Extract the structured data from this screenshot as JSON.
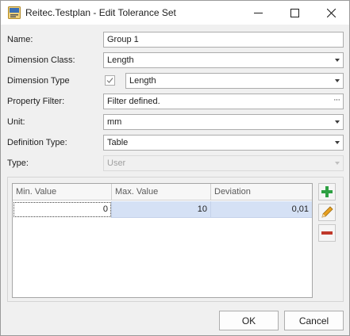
{
  "window": {
    "title": "Reitec.Testplan - Edit Tolerance Set",
    "icon": "reitec-app-icon",
    "controls": {
      "minimize": "minimize-icon",
      "maximize": "maximize-icon",
      "close": "close-icon"
    }
  },
  "form": {
    "name": {
      "label": "Name:",
      "value": "Group 1"
    },
    "dimension_class": {
      "label": "Dimension Class:",
      "value": "Length"
    },
    "dimension_type": {
      "label": "Dimension Type",
      "checked": true,
      "value": "Length"
    },
    "property_filter": {
      "label": "Property Filter:",
      "value": "Filter defined.",
      "button": "···"
    },
    "unit": {
      "label": "Unit:",
      "value": "mm"
    },
    "definition_type": {
      "label": "Definition Type:",
      "value": "Table"
    },
    "type": {
      "label": "Type:",
      "value": "User",
      "enabled": false
    }
  },
  "grid": {
    "columns": [
      "Min. Value",
      "Max. Value",
      "Deviation"
    ],
    "rows": [
      {
        "min": "0",
        "max": "10",
        "deviation": "0,01",
        "selected": true
      }
    ]
  },
  "side_buttons": [
    {
      "name": "add",
      "icon": "plus-icon",
      "color": "#2ea043"
    },
    {
      "name": "edit",
      "icon": "pencil-icon",
      "color": "#e8a020"
    },
    {
      "name": "remove",
      "icon": "minus-icon",
      "color": "#c0392b"
    }
  ],
  "buttons": {
    "ok": "OK",
    "cancel": "Cancel"
  }
}
